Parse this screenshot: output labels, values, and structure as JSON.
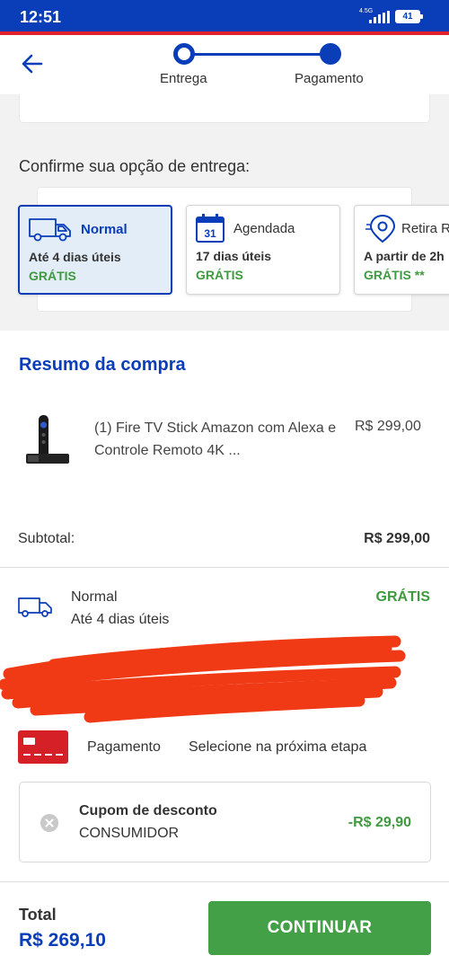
{
  "status_bar": {
    "time": "12:51",
    "network": "4.5G",
    "battery": "41"
  },
  "stepper": {
    "steps": [
      {
        "label": "Entrega"
      },
      {
        "label": "Pagamento"
      }
    ]
  },
  "delivery": {
    "title": "Confirme sua opção de entrega:",
    "options": [
      {
        "name": "Normal",
        "days": "Até 4 dias úteis",
        "price": "GRÁTIS",
        "icon": "truck-icon",
        "selected": true
      },
      {
        "name": "Agendada",
        "days": "17 dias úteis",
        "price": "GRÁTIS",
        "icon": "calendar-icon",
        "calendar_day": "31",
        "selected": false
      },
      {
        "name": "Retira R",
        "days": "A partir de 2h",
        "price": "GRÁTIS **",
        "icon": "location-pin-icon",
        "selected": false
      }
    ]
  },
  "summary": {
    "title": "Resumo da compra",
    "product": {
      "name": "(1) Fire TV Stick Amazon com Alexa e Controle Remoto 4K ...",
      "price": "R$ 299,00"
    },
    "subtotal_label": "Subtotal:",
    "subtotal_value": "R$ 299,00",
    "shipping": {
      "name": "Normal",
      "days": "Até 4 dias úteis",
      "price": "GRÁTIS"
    },
    "payment": {
      "label": "Pagamento",
      "value": "Selecione na próxima etapa"
    },
    "coupon": {
      "title": "Cupom de desconto",
      "code": "CONSUMIDOR",
      "discount": "-R$ 29,90"
    },
    "total_label": "Total",
    "total_value": "R$ 269,10",
    "continue_label": "CONTINUAR"
  },
  "colors": {
    "brand_blue": "#0a3db8",
    "brand_red": "#e2212a",
    "green": "#3f9a3f",
    "button_green": "#43a047",
    "redaction": "#f03a16"
  }
}
